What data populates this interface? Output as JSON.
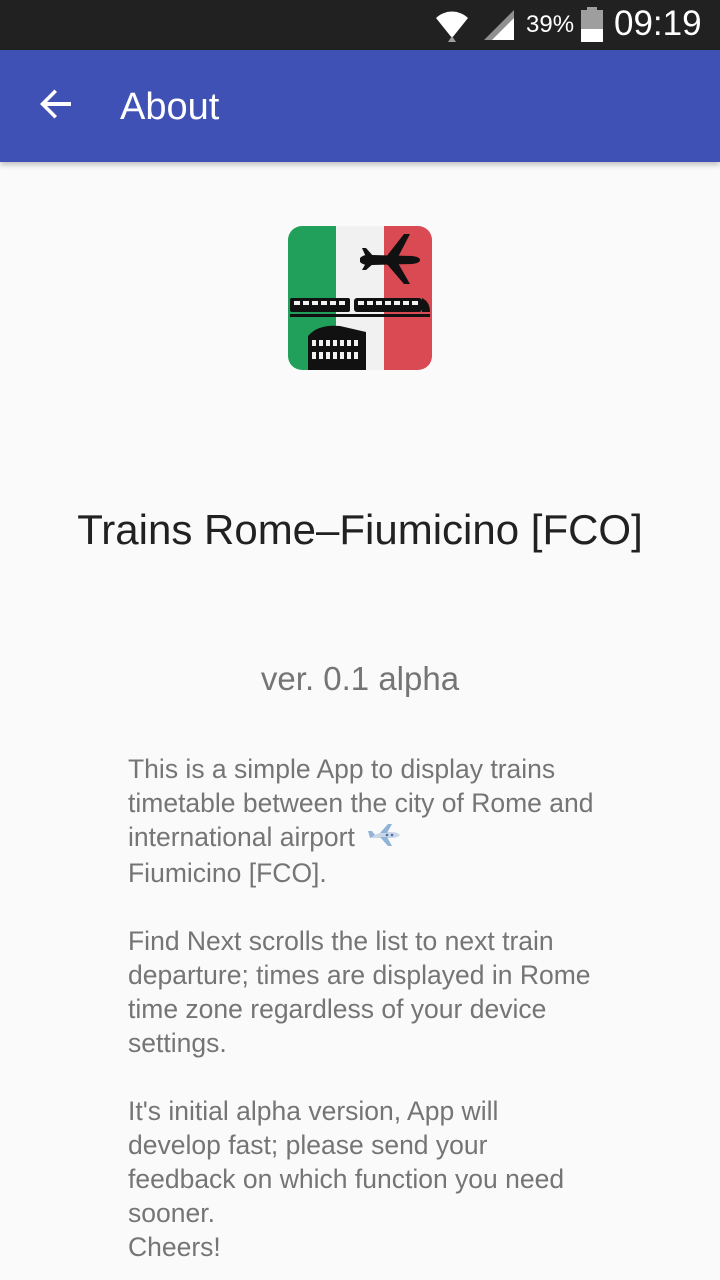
{
  "status_bar": {
    "battery_percent": "39%",
    "time": "09:19",
    "icons": [
      "wifi-icon",
      "signal-icon",
      "battery-icon"
    ]
  },
  "app_bar": {
    "title": "About",
    "back_icon": "arrow-back-icon",
    "color": "#3f51b5"
  },
  "about": {
    "logo_icon": "app-logo-italy-plane-train-colosseum",
    "app_name": "Trains Rome–Fiumicino [FCO]",
    "version": "ver. 0.1 alpha",
    "paragraph_1_text": "This is a simple App to display trains timetable between the city of Rome and international airport",
    "paragraph_1_end": "Fiumicino [FCO].",
    "paragraph_2": "Find Next scrolls the list to next train departure; times are displayed in Rome time zone regardless of your device settings.",
    "paragraph_3": "It's initial alpha version, App will develop fast; please send your feedback on which function you need sooner.",
    "sign_off": "Cheers!"
  }
}
